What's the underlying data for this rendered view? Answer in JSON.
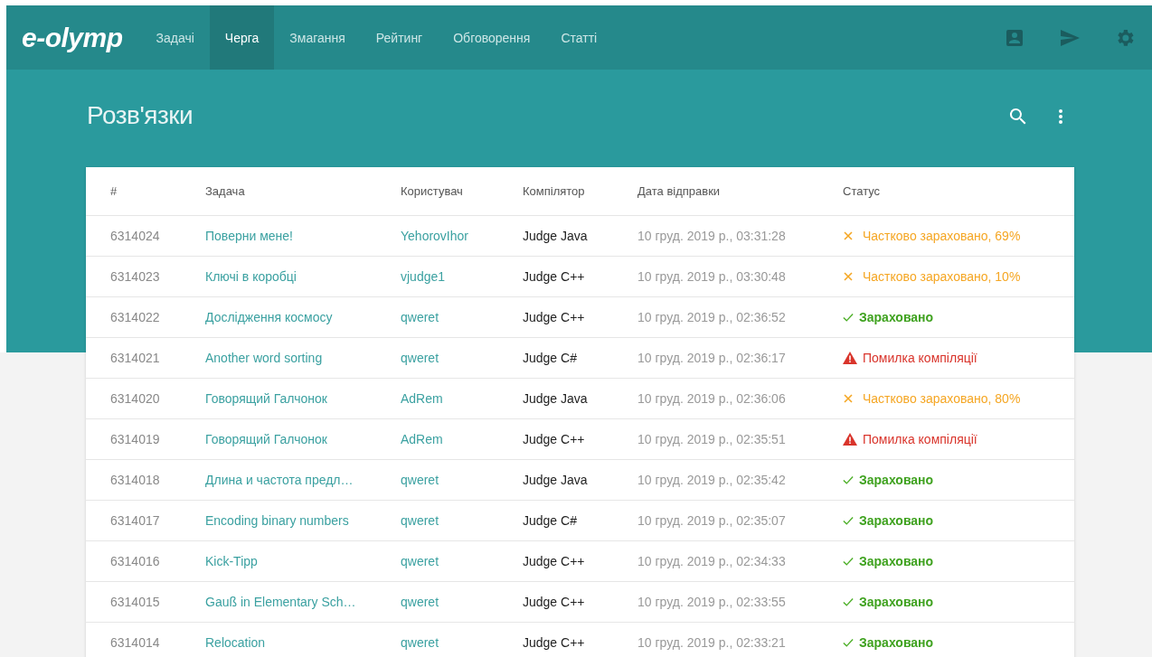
{
  "navbar": {
    "logo": "e-olymp",
    "tabs": [
      {
        "label": "Задачі",
        "selected": false
      },
      {
        "label": "Черга",
        "selected": true
      },
      {
        "label": "Змагання",
        "selected": false
      },
      {
        "label": "Рейтинг",
        "selected": false
      },
      {
        "label": "Обговорення",
        "selected": false
      },
      {
        "label": "Статті",
        "selected": false
      }
    ]
  },
  "page": {
    "title": "Розв'язки"
  },
  "table": {
    "columns": [
      "#",
      "Задача",
      "Користувач",
      "Компілятор",
      "Дата відправки",
      "Статус"
    ],
    "rows": [
      {
        "id": "6314024",
        "problem": "Поверни мене!",
        "user": "YehorovIhor",
        "compiler": "Judge Java",
        "date": "10 груд. 2019 р., 03:31:28",
        "status": {
          "kind": "partial",
          "text": "Частково зараховано, 69%"
        }
      },
      {
        "id": "6314023",
        "problem": "Ключі в коробці",
        "user": "vjudge1",
        "compiler": "Judge C++",
        "date": "10 груд. 2019 р., 03:30:48",
        "status": {
          "kind": "partial",
          "text": "Частково зараховано, 10%"
        }
      },
      {
        "id": "6314022",
        "problem": "Дослідження космосу",
        "user": "qweret",
        "compiler": "Judge C++",
        "date": "10 груд. 2019 р., 02:36:52",
        "status": {
          "kind": "accepted",
          "text": "Зараховано"
        }
      },
      {
        "id": "6314021",
        "problem": "Another word sorting",
        "user": "qweret",
        "compiler": "Judge C#",
        "date": "10 груд. 2019 р., 02:36:17",
        "status": {
          "kind": "error",
          "text": "Помилка компіляції"
        }
      },
      {
        "id": "6314020",
        "problem": "Говорящий Галчонок",
        "user": "AdRem",
        "compiler": "Judge Java",
        "date": "10 груд. 2019 р., 02:36:06",
        "status": {
          "kind": "partial",
          "text": "Частково зараховано, 80%"
        }
      },
      {
        "id": "6314019",
        "problem": "Говорящий Галчонок",
        "user": "AdRem",
        "compiler": "Judge C++",
        "date": "10 груд. 2019 р., 02:35:51",
        "status": {
          "kind": "error",
          "text": "Помилка компіляції"
        }
      },
      {
        "id": "6314018",
        "problem": "Длина и частота предл…",
        "user": "qweret",
        "compiler": "Judge Java",
        "date": "10 груд. 2019 р., 02:35:42",
        "status": {
          "kind": "accepted",
          "text": "Зараховано"
        }
      },
      {
        "id": "6314017",
        "problem": "Encoding binary numbers",
        "user": "qweret",
        "compiler": "Judge C#",
        "date": "10 груд. 2019 р., 02:35:07",
        "status": {
          "kind": "accepted",
          "text": "Зараховано"
        }
      },
      {
        "id": "6314016",
        "problem": "Kick-Tipp",
        "user": "qweret",
        "compiler": "Judge C++",
        "date": "10 груд. 2019 р., 02:34:33",
        "status": {
          "kind": "accepted",
          "text": "Зараховано"
        }
      },
      {
        "id": "6314015",
        "problem": "Gauß in Elementary Sch…",
        "user": "qweret",
        "compiler": "Judge C++",
        "date": "10 груд. 2019 р., 02:33:55",
        "status": {
          "kind": "accepted",
          "text": "Зараховано"
        }
      },
      {
        "id": "6314014",
        "problem": "Relocation",
        "user": "qweret",
        "compiler": "Judge C++",
        "date": "10 груд. 2019 р., 02:33:21",
        "status": {
          "kind": "accepted",
          "text": "Зараховано"
        }
      }
    ]
  }
}
